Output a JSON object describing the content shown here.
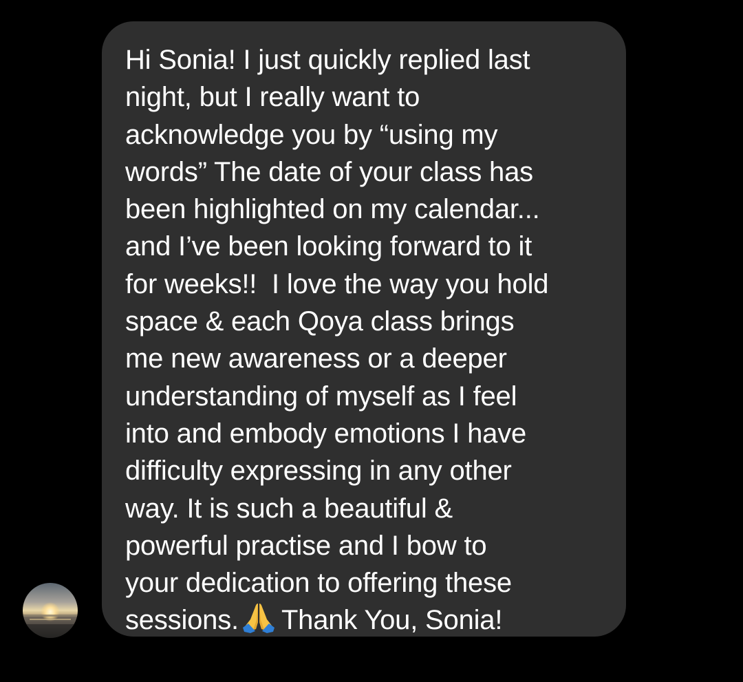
{
  "message": {
    "lines": [
      "Hi Sonia! I just quickly replied last",
      "night, but I really want to",
      "acknowledge you by “using my",
      "words” The date of your class has",
      "been highlighted on my calendar...",
      "and I’ve been looking forward to it",
      "for weeks!!  I love the way you hold",
      "space & each Qoya class brings",
      "me new awareness or a deeper",
      "understanding of myself as I feel",
      "into and embody emotions I have",
      "difficulty expressing in any other",
      "way. It is such a beautiful &",
      "powerful practise and I bow to",
      "your dedication to offering these"
    ],
    "last_line_before": "sessions.",
    "emoji": "folded-hands-icon",
    "last_line_after": "Thank You, Sonia!"
  },
  "sender": {
    "avatar": "sunset-avatar"
  },
  "colors": {
    "background": "#000000",
    "bubble": "#2f2f2f",
    "text": "#ffffff"
  }
}
